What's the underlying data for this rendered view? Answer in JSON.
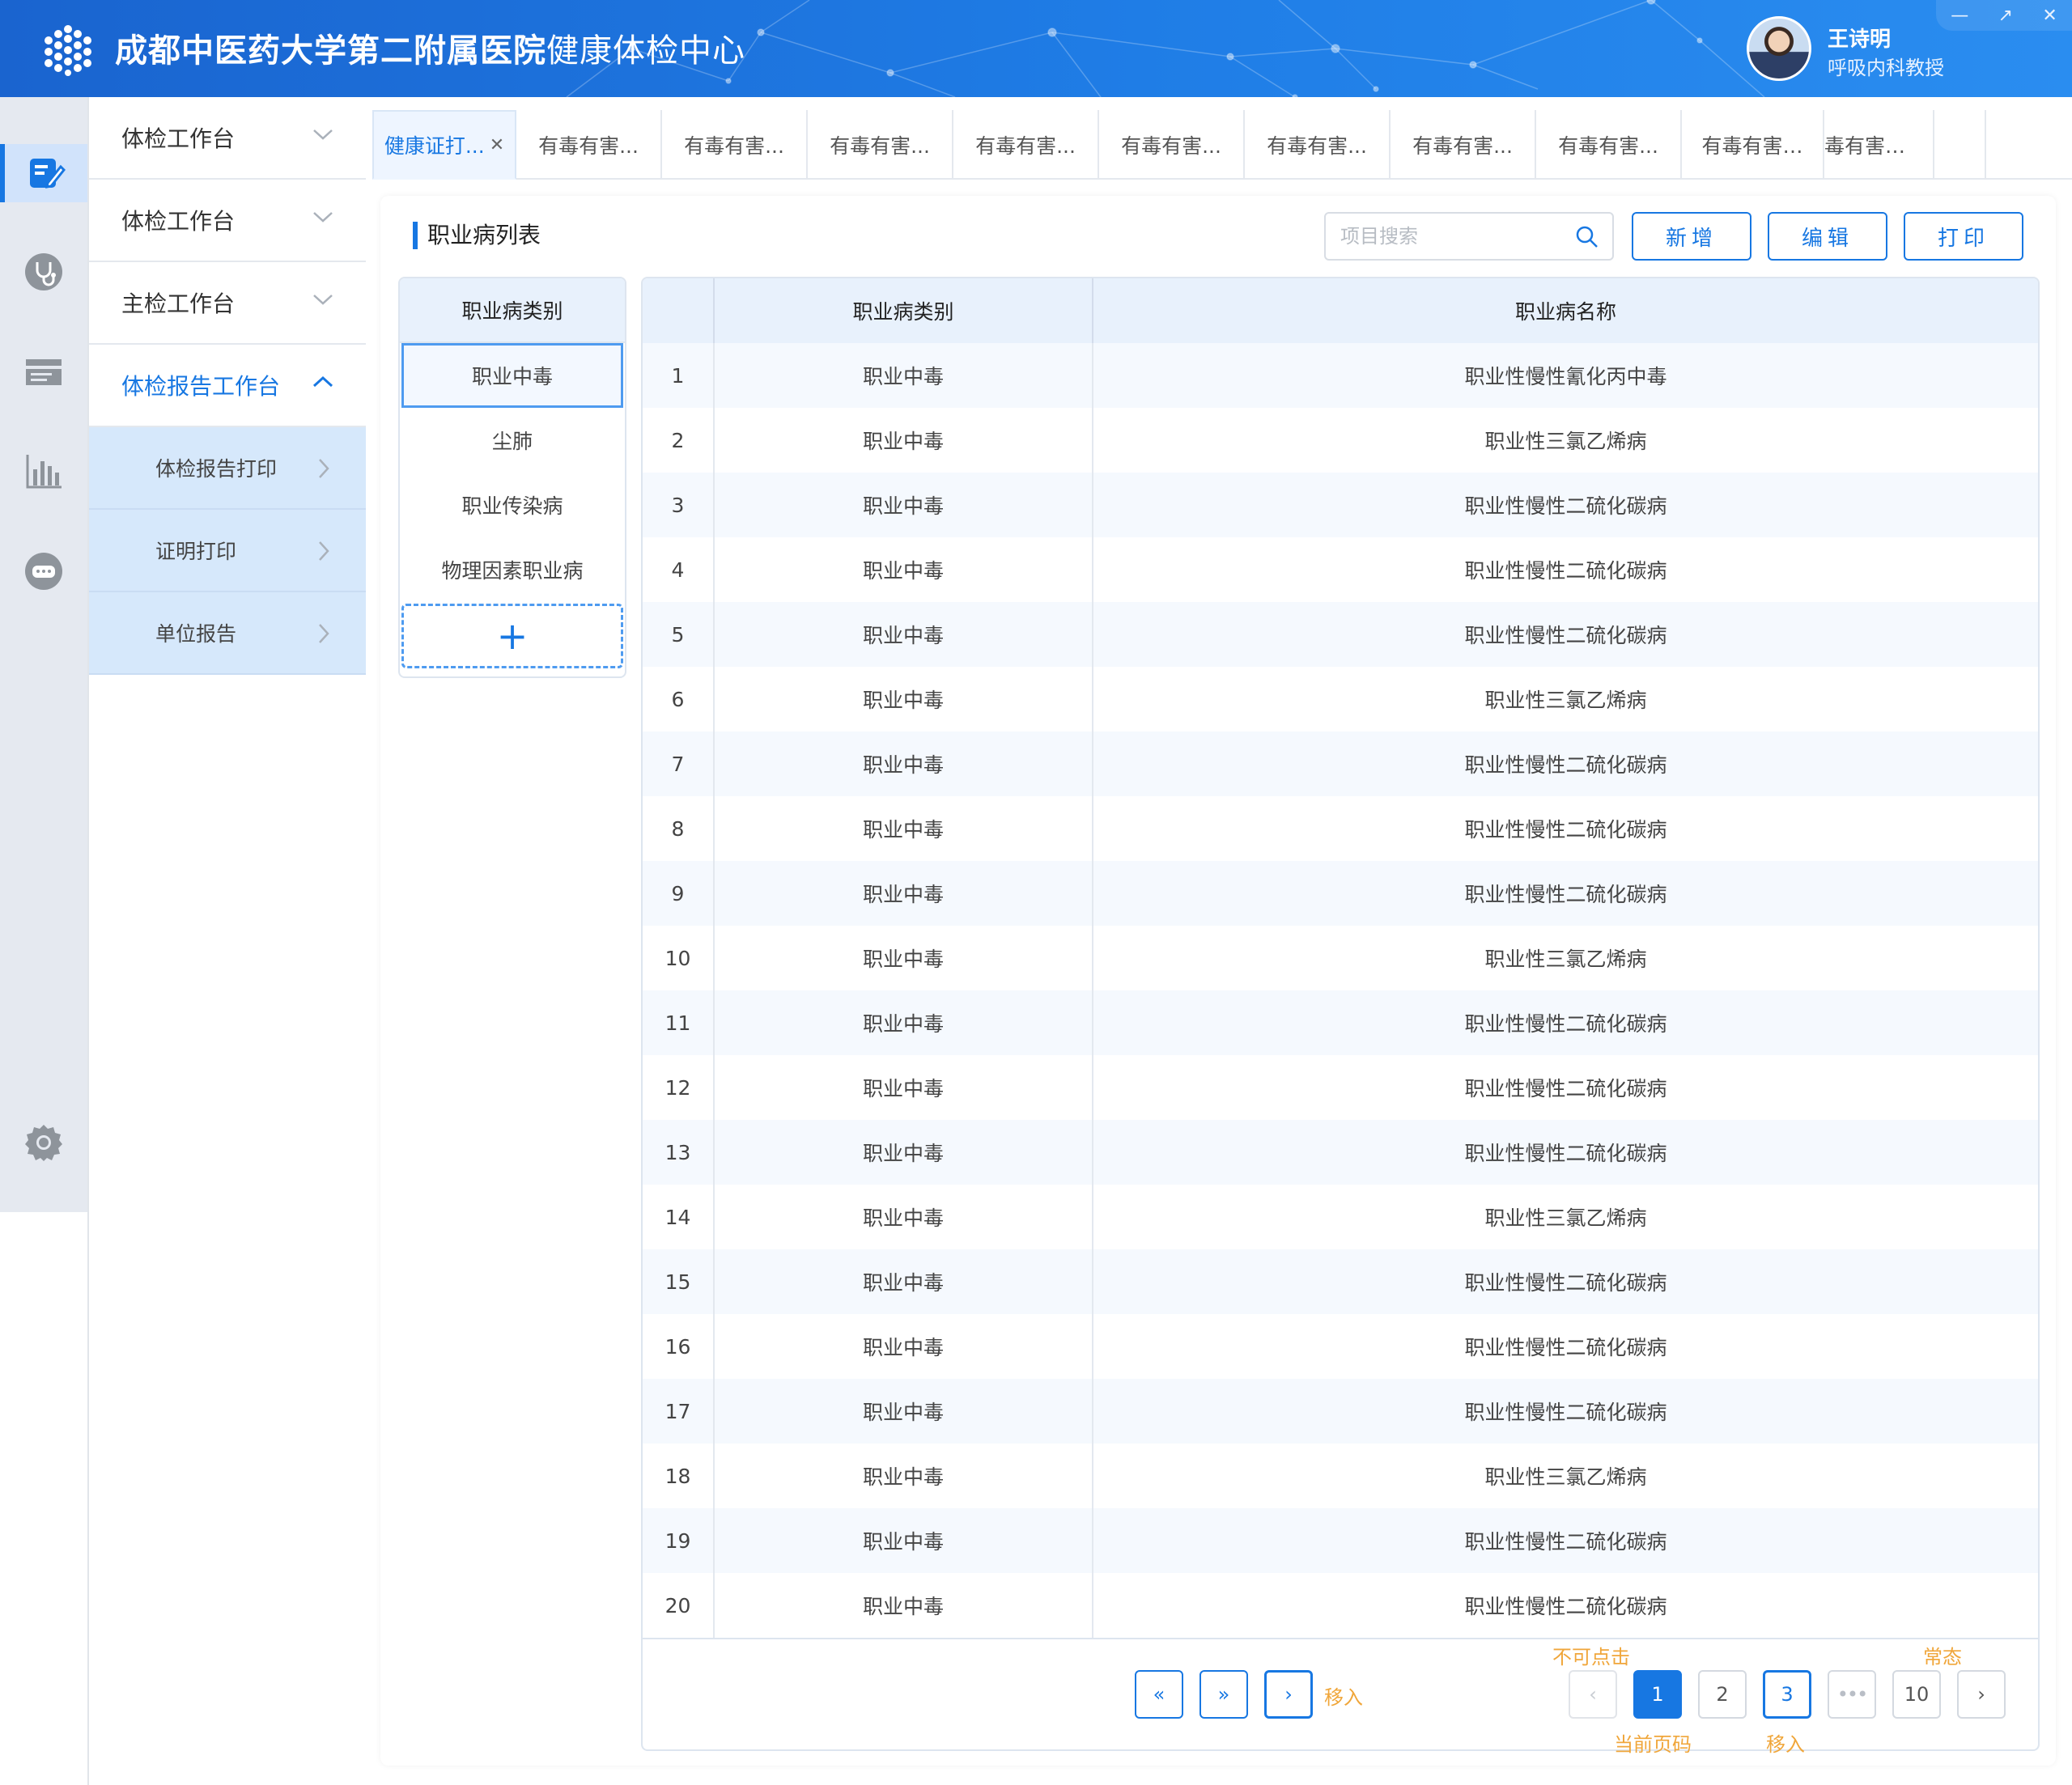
{
  "app": {
    "title_bold": "成都中医药大学第二附属医院",
    "title_light": "健康体检中心",
    "user_name": "王诗明",
    "user_role": "呼吸内科教授",
    "window_buttons": [
      "—",
      "↗",
      "✕"
    ]
  },
  "colors": {
    "primary": "#1777e2",
    "header": "#1f7de6",
    "note": "#f0a63a"
  },
  "iconbar": [
    "edit-icon",
    "stethoscope-icon",
    "report-list-icon",
    "bar-chart-icon",
    "gamepad-icon",
    "settings-icon"
  ],
  "menu": {
    "items": [
      {
        "label": "体检工作台"
      },
      {
        "label": "体检工作台"
      },
      {
        "label": "主检工作台"
      },
      {
        "label": "体检报告工作台"
      }
    ],
    "subitems": [
      {
        "label": "体检报告打印"
      },
      {
        "label": "证明打印"
      },
      {
        "label": "单位报告"
      }
    ]
  },
  "tabs": [
    "健康证打...",
    "有毒有害...",
    "有毒有害...",
    "有毒有害...",
    "有毒有害...",
    "有毒有害...",
    "有毒有害...",
    "有毒有害...",
    "有毒有害...",
    "有毒有害…",
    "毒有害…"
  ],
  "panel": {
    "title": "职业病列表",
    "search_placeholder": "项目搜索",
    "btn_add": "新增",
    "btn_edit": "编辑",
    "btn_print": "打印"
  },
  "categories": {
    "header": "职业病类别",
    "items": [
      "职业中毒",
      "尘肺",
      "职业传染病",
      "物理因素职业病"
    ],
    "add": "+"
  },
  "table": {
    "headers": [
      "",
      "职业病类别",
      "职业病名称"
    ],
    "rows": [
      [
        "1",
        "职业中毒",
        "职业性慢性氰化丙中毒"
      ],
      [
        "2",
        "职业中毒",
        "职业性三氯乙烯病"
      ],
      [
        "3",
        "职业中毒",
        "职业性慢性二硫化碳病"
      ],
      [
        "4",
        "职业中毒",
        "职业性慢性二硫化碳病"
      ],
      [
        "5",
        "职业中毒",
        "职业性慢性二硫化碳病"
      ],
      [
        "6",
        "职业中毒",
        "职业性三氯乙烯病"
      ],
      [
        "7",
        "职业中毒",
        "职业性慢性二硫化碳病"
      ],
      [
        "8",
        "职业中毒",
        "职业性慢性二硫化碳病"
      ],
      [
        "9",
        "职业中毒",
        "职业性慢性二硫化碳病"
      ],
      [
        "10",
        "职业中毒",
        "职业性三氯乙烯病"
      ],
      [
        "11",
        "职业中毒",
        "职业性慢性二硫化碳病"
      ],
      [
        "12",
        "职业中毒",
        "职业性慢性二硫化碳病"
      ],
      [
        "13",
        "职业中毒",
        "职业性慢性二硫化碳病"
      ],
      [
        "14",
        "职业中毒",
        "职业性三氯乙烯病"
      ],
      [
        "15",
        "职业中毒",
        "职业性慢性二硫化碳病"
      ],
      [
        "16",
        "职业中毒",
        "职业性慢性二硫化碳病"
      ],
      [
        "17",
        "职业中毒",
        "职业性慢性二硫化碳病"
      ],
      [
        "18",
        "职业中毒",
        "职业性三氯乙烯病"
      ],
      [
        "19",
        "职业中毒",
        "职业性慢性二硫化碳病"
      ],
      [
        "20",
        "职业中毒",
        "职业性慢性二硫化碳病"
      ]
    ]
  },
  "pager": {
    "first": "«",
    "last": "»",
    "next_group": "›",
    "note_move1": "移入",
    "note_disabled": "不可点击",
    "note_normal": "常态",
    "note_current": "当前页码",
    "note_move2": "移入",
    "prev": "‹",
    "pages": [
      "1",
      "2",
      "3",
      "•••",
      "10"
    ],
    "next": "›",
    "current_page": 1
  }
}
